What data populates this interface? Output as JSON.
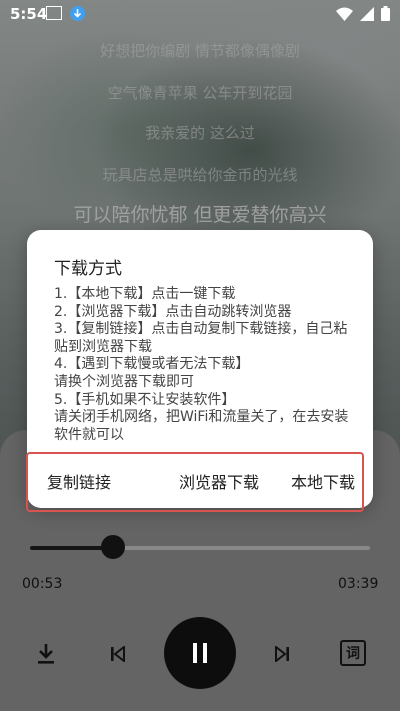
{
  "status_bar": {
    "time": "5:54"
  },
  "lyrics": {
    "lines": [
      "好想把你编剧 情节都像偶像剧",
      "空气像青苹果 公车开到花园",
      "我亲爱的 这么过",
      "玩具店总是哄给你金币的光线"
    ],
    "current": "可以陪你忧郁 但更爱替你高兴"
  },
  "dialog": {
    "title": "下载方式",
    "message": "1.【本地下载】点击一键下载\n2.【浏览器下载】点击自动跳转浏览器\n3.【复制链接】点击自动复制下载链接，自己粘贴到浏览器下载\n4.【遇到下载慢或者无法下载】\n请换个浏览器下载即可\n5.【手机如果不让安装软件】\n请关闭手机网络，把WiFi和流量关了，在去安装软件就可以",
    "actions": {
      "copy_link": "复制链接",
      "browser_download": "浏览器下载",
      "local_download": "本地下载"
    }
  },
  "player": {
    "elapsed": "00:53",
    "total": "03:39",
    "progress_fraction": 0.245,
    "lyrics_button_label": "词"
  },
  "icons": {
    "download": "download-icon",
    "previous": "previous-icon",
    "pause": "pause-icon",
    "next": "next-icon",
    "lyrics": "lyrics-icon"
  },
  "colors": {
    "accent_highlight": "#d9534f",
    "play_button": "#0d0d0d"
  }
}
